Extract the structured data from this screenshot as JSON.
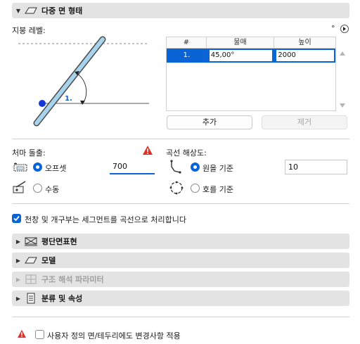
{
  "sections": {
    "multi_plane": {
      "title": "다중 면 형태",
      "expanded": true
    },
    "floor_plan": {
      "title": "평단면표현"
    },
    "model": {
      "title": "모델"
    },
    "structural": {
      "title": "구조 해석 파라미터",
      "disabled": true
    },
    "classification": {
      "title": "분류 및 속성"
    }
  },
  "roof_level": {
    "label": "지붕 레벨:",
    "degree_symbol": "°",
    "preview_level_label": "1.",
    "table": {
      "columns": [
        "#",
        "물매",
        "높이"
      ],
      "rows": [
        {
          "index": "1.",
          "pitch": "45,00°",
          "height": "2000",
          "selected": true
        }
      ]
    },
    "add_button": "추가",
    "remove_button": "제거"
  },
  "eaves": {
    "label": "처마 돌출:",
    "option_offset": "오프셋",
    "option_manual": "수동",
    "selected": "offset",
    "offset_value": "700"
  },
  "curve": {
    "label": "곡선 해상도:",
    "option_circle": "원을 기준",
    "option_arc": "호를 기준",
    "selected": "circle",
    "value": "10"
  },
  "segment_checkbox": {
    "label": "천창 및 개구부는 세그먼트를 곡선으로 처리합니다",
    "checked": true
  },
  "footer": {
    "apply_label": "사용자 정의 면/테두리에도 변경사항 적용",
    "checked": false
  },
  "colors": {
    "accent": "#0a64d6",
    "warning": "#d9342b",
    "roof_fill": "#a7d3ec"
  }
}
